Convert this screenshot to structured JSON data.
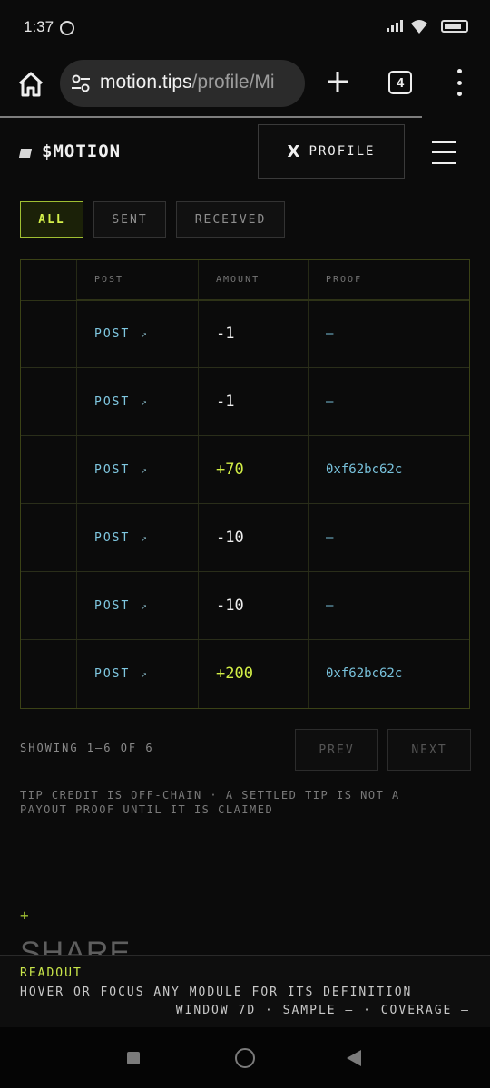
{
  "status": {
    "time": "1:37"
  },
  "browser": {
    "url_domain": "motion.tips",
    "url_path": "/profile/Mi",
    "tab_count": "4"
  },
  "header": {
    "brand": "$MOTION",
    "profile_icon": "X",
    "profile_label": "PROFILE"
  },
  "filters": [
    {
      "label": "ALL",
      "active": true
    },
    {
      "label": "SENT",
      "active": false
    },
    {
      "label": "RECEIVED",
      "active": false
    }
  ],
  "table": {
    "columns": [
      "POST",
      "AMOUNT",
      "PROOF"
    ],
    "rows": [
      {
        "post": "POST",
        "arrow": "↗",
        "amount": "-1",
        "proof": "—"
      },
      {
        "post": "POST",
        "arrow": "↗",
        "amount": "-1",
        "proof": "—"
      },
      {
        "post": "POST",
        "arrow": "↗",
        "amount": "+70",
        "proof": "0xf62bc62c"
      },
      {
        "post": "POST",
        "arrow": "↗",
        "amount": "-10",
        "proof": "—"
      },
      {
        "post": "POST",
        "arrow": "↗",
        "amount": "-10",
        "proof": "—"
      },
      {
        "post": "POST",
        "arrow": "↗",
        "amount": "+200",
        "proof": "0xf62bc62c"
      }
    ]
  },
  "pagination": {
    "showing": "SHOWING 1–6 OF 6",
    "prev": "PREV",
    "next": "NEXT"
  },
  "note": "TIP CREDIT IS OFF-CHAIN · A SETTLED TIP IS NOT A PAYOUT PROOF UNTIL IT IS CLAIMED",
  "section": {
    "plus": "+",
    "title": "SHARE"
  },
  "readout": {
    "title": "READOUT",
    "description": "HOVER OR FOCUS ANY MODULE FOR ITS DEFINITION",
    "meta": "WINDOW 7D · SAMPLE — · COVERAGE —"
  },
  "colors": {
    "accent": "#d2ee46",
    "link": "#7fc7e0",
    "background": "#0b0b0b"
  }
}
